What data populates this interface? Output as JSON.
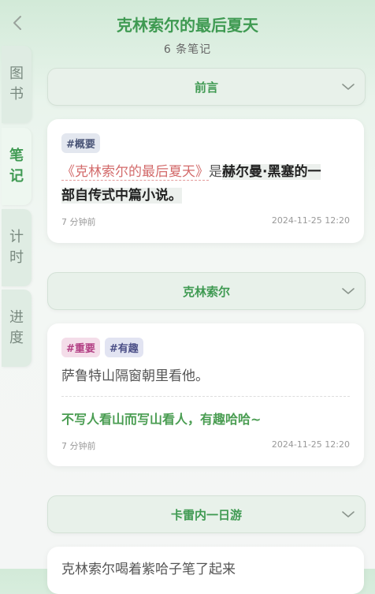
{
  "header": {
    "title": "克林索尔的最后夏天",
    "subtitle": "6 条笔记"
  },
  "sidebar": {
    "tabs": [
      {
        "chars": [
          "图",
          "书"
        ],
        "active": false
      },
      {
        "chars": [
          "笔",
          "记"
        ],
        "active": true
      },
      {
        "chars": [
          "计",
          "时"
        ],
        "active": false
      },
      {
        "chars": [
          "进",
          "度"
        ],
        "active": false
      }
    ]
  },
  "sections": [
    {
      "title": "前言"
    },
    {
      "title": "克林索尔"
    },
    {
      "title": "卡雷内一日游"
    }
  ],
  "notes": [
    {
      "tags": [
        "#概要"
      ],
      "quote_open": "《",
      "quote_title": "克林索尔的最后夏天",
      "quote_close": "》",
      "text_mid": "是",
      "text_highlight_1": "赫尔曼·黑塞的一",
      "text_highlight_2": "部自传式中篇小说。",
      "time_ago": "7 分钟前",
      "date": "2024-11-25 12:20"
    },
    {
      "tags": [
        "#重要",
        "#有趣"
      ],
      "text": "萨鲁特山隔窗朝里看他。",
      "comment": "不写人看山而写山看人，有趣哈哈~",
      "time_ago": "7 分钟前",
      "date": "2024-11-25 12:20"
    },
    {
      "text_partial": "克林索尔喝着紫哈子笔了起来"
    }
  ],
  "colors": {
    "accent": "#3f9a52",
    "quote": "#d36b6b"
  }
}
